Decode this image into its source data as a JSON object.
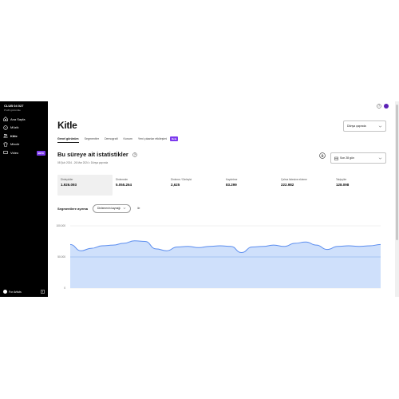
{
  "sidebar": {
    "artist_name": "CLUB 04 027",
    "artist_subtitle": "Profili görüntüle",
    "items": [
      {
        "label": "Ana Sayfa",
        "icon": "home-icon"
      },
      {
        "label": "Müzik",
        "icon": "music-icon"
      },
      {
        "label": "Kitle",
        "icon": "audience-icon"
      },
      {
        "label": "Mixciir",
        "icon": "merch-icon"
      },
      {
        "label": "Video",
        "icon": "video-icon",
        "badge": "BETA"
      }
    ],
    "footer": {
      "label": "For Artists"
    }
  },
  "header": {
    "title": "Kitle",
    "region": "Dünya çapında"
  },
  "tabs": [
    {
      "label": "Genel görünüm",
      "active": true
    },
    {
      "label": "Segmentler"
    },
    {
      "label": "Demografi"
    },
    {
      "label": "Konum"
    },
    {
      "label": "Yeni çıkanlar etkileşimi",
      "badge": "Beta"
    }
  ],
  "stats_section": {
    "title": "Bu süreye ait istatistikler",
    "date_range": "08 Şub 2024 - 26 Mar 2024 • Dünya çapında",
    "range_select": "Son 28 gün",
    "stats": [
      {
        "label": "Dinleyiciler",
        "value": "1.926.093"
      },
      {
        "label": "Dinlemeler",
        "value": "5.055.264"
      },
      {
        "label": "Dinleme / Dinleyici",
        "value": "2,625"
      },
      {
        "label": "Kaydetme",
        "value": "83.299"
      },
      {
        "label": "Çalma listesine ekleme",
        "value": "222.982"
      },
      {
        "label": "Takipçiler",
        "value": "128.098"
      }
    ]
  },
  "segment": {
    "label": "Segmentlere ayırma",
    "dimension": "Dinlemenin kaynağı",
    "vs": "ile"
  },
  "chart_data": {
    "type": "area",
    "title": "",
    "xlabel": "",
    "ylabel": "",
    "y_ticks": [
      "100.000",
      "50.000",
      "0"
    ],
    "ylim": [
      0,
      100000
    ],
    "series": [
      {
        "values": [
          70000,
          60000,
          64000,
          68000,
          69000,
          72000,
          76000,
          75000,
          63000,
          60000,
          66000,
          67000,
          65000,
          67000,
          68000,
          67000,
          57000,
          66000,
          67000,
          69000,
          67000,
          72000,
          74000,
          69000,
          62000,
          67000,
          68000,
          67000,
          68000,
          70000
        ],
        "color": "#5b8def",
        "fill": "#cfe0fb"
      }
    ],
    "grid": true
  }
}
